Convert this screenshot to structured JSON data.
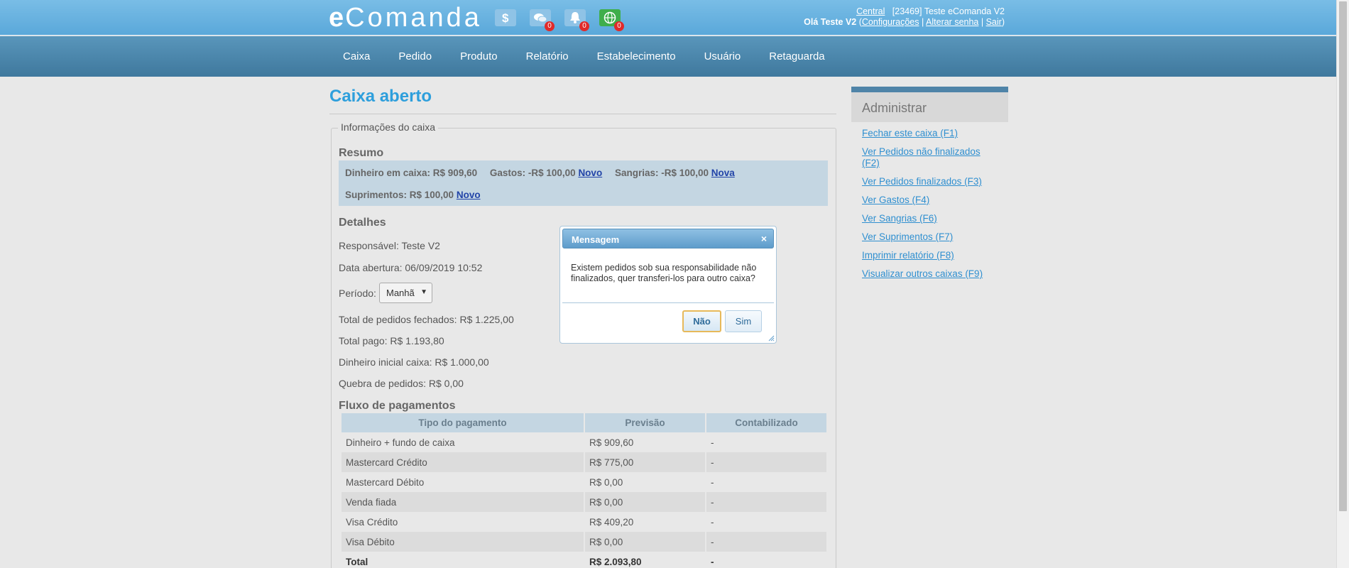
{
  "header": {
    "logo_e": "e",
    "logo_rest": "Comanda",
    "icons": [
      {
        "name": "money-icon",
        "badge": ""
      },
      {
        "name": "chat-icon",
        "badge": "0"
      },
      {
        "name": "bell-icon",
        "badge": "0"
      },
      {
        "name": "globe-icon",
        "badge": "0"
      }
    ],
    "central_link": "Central",
    "account": "[23469] Teste eComanda V2",
    "greeting_prefix": "Olá",
    "user": "Teste V2",
    "config_link": "Configurações",
    "sep1": " | ",
    "change_password_link": "Alterar senha",
    "sep2": " | ",
    "logout_link": "Sair"
  },
  "nav": [
    "Caixa",
    "Pedido",
    "Produto",
    "Relatório",
    "Estabelecimento",
    "Usuário",
    "Retaguarda"
  ],
  "main": {
    "title": "Caixa aberto",
    "legend": "Informações do caixa",
    "resumo_heading": "Resumo",
    "resumo": {
      "dinheiro": "Dinheiro em caixa: R$ 909,60",
      "gastos": "Gastos: -R$ 100,00",
      "gastos_link": "Novo",
      "sangrias": "Sangrias: -R$ 100,00",
      "sangrias_link": "Nova",
      "suprimentos": "Suprimentos: R$ 100,00",
      "suprimentos_link": "Novo"
    },
    "detalhes_heading": "Detalhes",
    "responsavel": "Responsável: Teste V2",
    "data_abertura": "Data abertura: 06/09/2019 10:52",
    "periodo_label": "Período:",
    "periodo_value": "Manhã",
    "total_fechados": "Total de pedidos fechados: R$ 1.225,00",
    "total_pago": "Total pago: R$ 1.193,80",
    "dinheiro_inicial": "Dinheiro inicial caixa: R$ 1.000,00",
    "quebra": "Quebra de pedidos: R$ 0,00",
    "fluxo_heading": "Fluxo de pagamentos",
    "table": {
      "headers": [
        "Tipo do pagamento",
        "Previsão",
        "Contabilizado"
      ],
      "rows": [
        [
          "Dinheiro + fundo de caixa",
          "R$ 909,60",
          "-"
        ],
        [
          "Mastercard Crédito",
          "R$ 775,00",
          "-"
        ],
        [
          "Mastercard Débito",
          "R$ 0,00",
          "-"
        ],
        [
          "Venda fiada",
          "R$ 0,00",
          "-"
        ],
        [
          "Visa Crédito",
          "R$ 409,20",
          "-"
        ],
        [
          "Visa Débito",
          "R$ 0,00",
          "-"
        ],
        [
          "Total",
          "R$ 2.093,80",
          "-"
        ]
      ]
    }
  },
  "sidebar": {
    "title": "Administrar",
    "links": [
      "Fechar este caixa (F1)",
      "Ver Pedidos não finalizados (F2)",
      "Ver Pedidos finalizados (F3)",
      "Ver Gastos (F4)",
      "Ver Sangrias (F6)",
      "Ver Suprimentos (F7)",
      "Imprimir relatório (F8)",
      "Visualizar outros caixas (F9)"
    ]
  },
  "dialog": {
    "title": "Mensagem",
    "close": "×",
    "message": "Existem pedidos sob sua responsabilidade não finalizados, quer transferi-los para outro caixa?",
    "no_label": "Não",
    "yes_label": "Sim"
  }
}
